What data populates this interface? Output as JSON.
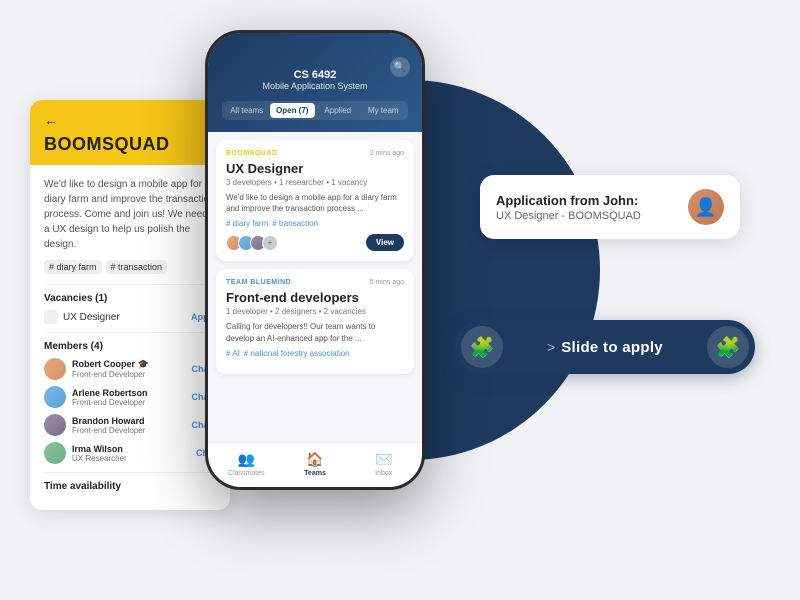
{
  "app": {
    "title": "CS 6492 Mobile Application System"
  },
  "background_circle": {
    "color": "#1e3a5f"
  },
  "left_panel": {
    "back_label": "←",
    "team_name": "BOOMSQUAD",
    "description": "We'd like to design a mobile app for a diary farm and improve the transaction process. Come and join us! We need a UX design to help us polish the design.",
    "tags": [
      "# diary farm",
      "# transaction"
    ],
    "vacancies_section": "Vacancies (1)",
    "vacancies": [
      {
        "role": "UX Designer",
        "action": "Apply"
      }
    ],
    "members_section": "Members (4)",
    "members": [
      {
        "name": "Robert Cooper",
        "role": "Front-end Developer",
        "emoji": "🎓",
        "action": "Cha..."
      },
      {
        "name": "Arlene Robertson",
        "role": "Front-end Developer",
        "action": "Cha..."
      },
      {
        "name": "Brandon Howard",
        "role": "Front-end Developer",
        "action": "Cha..."
      },
      {
        "name": "Irma Wilson",
        "role": "UX Researcher",
        "action": "Chat"
      }
    ],
    "time_section": "Time availability"
  },
  "phone": {
    "course_id": "CS 6492",
    "course_name": "Mobile Application System",
    "tabs": [
      "All teams",
      "Open (7)",
      "Applied",
      "My team"
    ],
    "active_tab": "Open (7)",
    "teams": [
      {
        "label": "BOOMSQUAD",
        "label_color": "yellow",
        "time": "2 mins ago",
        "name": "UX Designer",
        "slots": "3 developers • 1 researcher • 1 vacancy",
        "description": "We'd like to design a mobile app for a diary farm and improve the transaction process ...",
        "tags": [
          "# diary farm",
          "# transaction"
        ],
        "has_view_button": true
      },
      {
        "label": "TEAM BLUEMIND",
        "label_color": "blue",
        "time": "5 mins ago",
        "name": "Front-end developers",
        "slots": "1 developer • 2 designers • 2 vacancies",
        "description": "Calling for developers!! Our team wants to develop an AI-enhanced app for the ...",
        "tags": [
          "# AI",
          "# national forestry association"
        ],
        "has_view_button": false
      }
    ],
    "nav": [
      {
        "icon": "👥",
        "label": "Classmates",
        "active": false
      },
      {
        "icon": "🏠",
        "label": "Teams",
        "active": true
      },
      {
        "icon": "✉️",
        "label": "Inbox",
        "active": false
      }
    ]
  },
  "application_card": {
    "title": "Application from John:",
    "subtitle": "UX Designer - BOOMSQUAD"
  },
  "slide_to_apply": {
    "text": "Slide to apply",
    "chevron": ">",
    "left_icon": "🧩",
    "right_icon": "🧩"
  }
}
